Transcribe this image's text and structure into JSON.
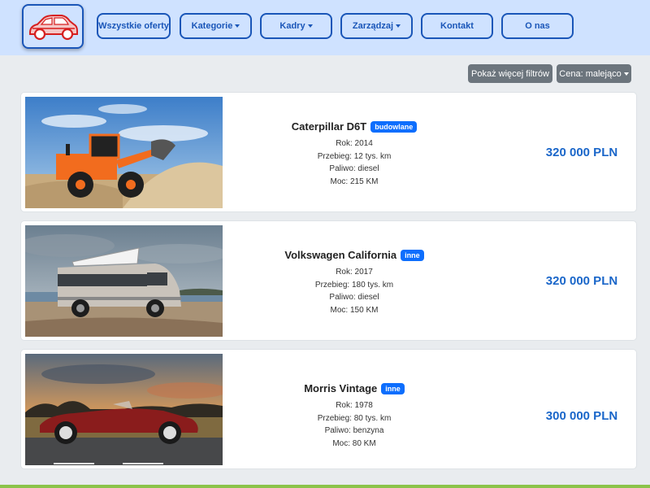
{
  "nav": {
    "items": [
      {
        "label": "Wszystkie oferty",
        "dropdown": false
      },
      {
        "label": "Kategorie",
        "dropdown": true
      },
      {
        "label": "Kadry",
        "dropdown": true
      },
      {
        "label": "Zarządzaj",
        "dropdown": true
      },
      {
        "label": "Kontakt",
        "dropdown": false
      },
      {
        "label": "O nas",
        "dropdown": false
      }
    ]
  },
  "filters": {
    "more_filters": "Pokaż więcej filtrów",
    "sort": "Cena: malejąco"
  },
  "listings": [
    {
      "name": "Caterpillar D6T",
      "category": "budowlane",
      "year": "Rok: 2014",
      "mileage": "Przebieg: 12 tys. km",
      "fuel": "Paliwo: diesel",
      "power": "Moc: 215 KM",
      "price": "320 000 PLN",
      "image": "wheel-loader-photo"
    },
    {
      "name": "Volkswagen California",
      "category": "inne",
      "year": "Rok: 2017",
      "mileage": "Przebieg: 180 tys. km",
      "fuel": "Paliwo: diesel",
      "power": "Moc: 150 KM",
      "price": "320 000 PLN",
      "image": "camper-van-photo"
    },
    {
      "name": "Morris Vintage",
      "category": "inne",
      "year": "Rok: 1978",
      "mileage": "Przebieg: 80 tys. km",
      "fuel": "Paliwo: benzyna",
      "power": "Moc: 80 KM",
      "price": "300 000 PLN",
      "image": "vintage-roadster-photo"
    }
  ],
  "colors": {
    "navbar_bg": "#cfe2ff",
    "accent": "#1a56b8",
    "badge": "#0d6efd",
    "price": "#1a66c9",
    "filter_btn": "#6c757d"
  }
}
